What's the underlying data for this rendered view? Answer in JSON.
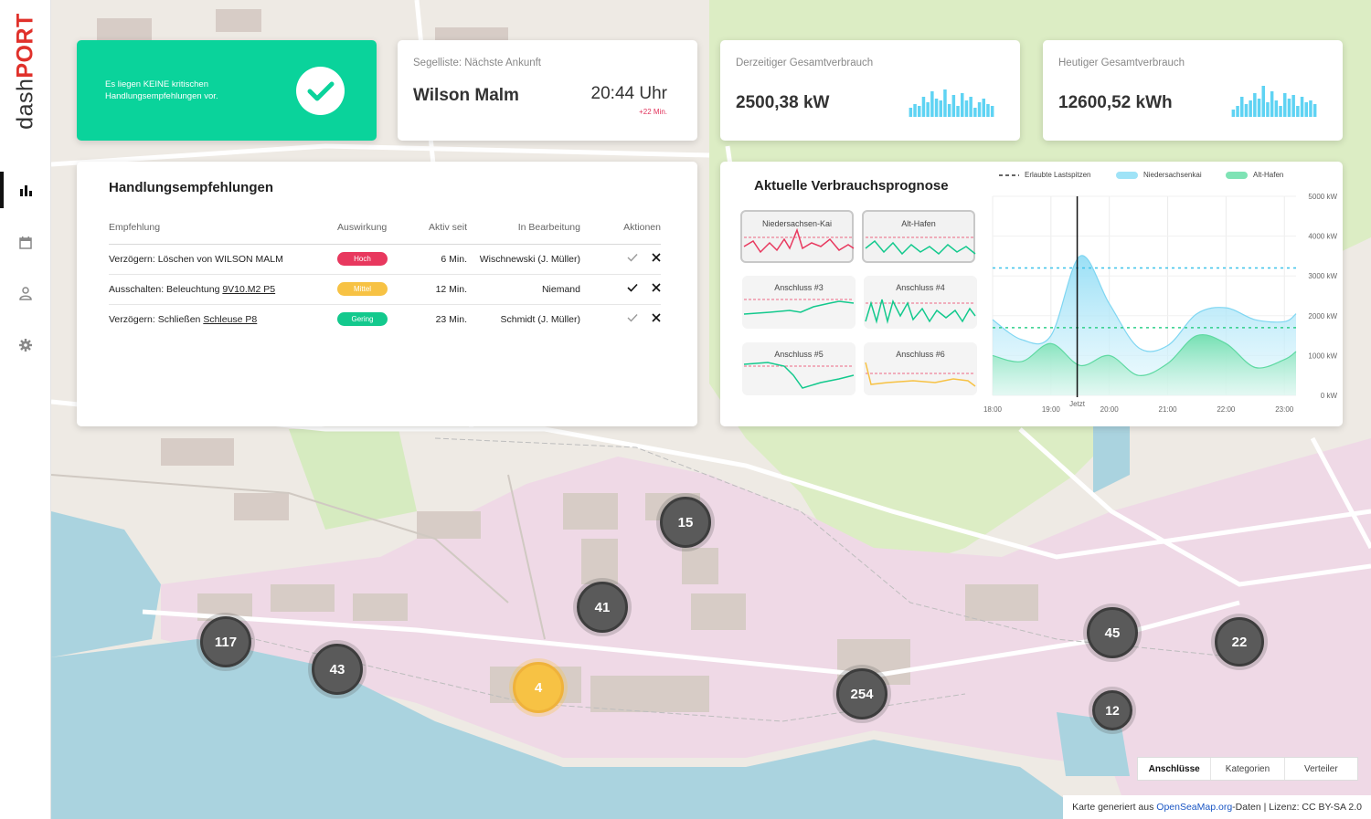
{
  "sidebar": {
    "logo_dash": "dash",
    "logo_port": "PORT",
    "nav": [
      {
        "icon": "bar-chart-icon",
        "active": true
      },
      {
        "icon": "calendar-icon",
        "active": false
      },
      {
        "icon": "user-icon",
        "active": false
      },
      {
        "icon": "gear-icon",
        "active": false
      }
    ]
  },
  "alert": {
    "text": "Es liegen KEINE kritischen Handlungsempfehlungen vor.",
    "icon": "check-icon",
    "color": "#0ad39b"
  },
  "arrival": {
    "label": "Segelliste: Nächste Ankunft",
    "ship": "Wilson Malm",
    "time": "20:44 Uhr",
    "delay": "+22 Min."
  },
  "current_consumption": {
    "label": "Derzeitiger Gesamtverbrauch",
    "value": "2500,38 kW"
  },
  "daily_consumption": {
    "label": "Heutiger Gesamtverbrauch",
    "value": "12600,52 kWh"
  },
  "recommendations": {
    "title": "Handlungsempfehlungen",
    "columns": [
      "Empfehlung",
      "Auswirkung",
      "Aktiv seit",
      "In Bearbeitung",
      "Aktionen"
    ],
    "rows": [
      {
        "prefix": "Verzögern: Löschen von WILSON MALM",
        "link": "",
        "impact": "Hoch",
        "impact_color": "#e8385e",
        "since": "6 Min.",
        "assignee": "Wischnewski (J. Müller)",
        "confirmed": false
      },
      {
        "prefix": "Ausschalten: Beleuchtung ",
        "link": "9V10.M2 P5",
        "impact": "Mittel",
        "impact_color": "#f7c244",
        "since": "12 Min.",
        "assignee": "Niemand",
        "confirmed": true
      },
      {
        "prefix": "Verzögern: Schließen ",
        "link": "Schleuse P8",
        "impact": "Gering",
        "impact_color": "#13c98d",
        "since": "23 Min.",
        "assignee": "Schmidt (J. Müller)",
        "confirmed": false
      }
    ]
  },
  "forecast": {
    "title": "Aktuelle Verbrauchsprognose",
    "sparks": [
      {
        "label": "Niedersachsen-Kai",
        "selected": true,
        "color": "#e8385e"
      },
      {
        "label": "Alt-Hafen",
        "selected": true,
        "color": "#13c98d"
      },
      {
        "label": "Anschluss #3",
        "selected": false,
        "color": "#13c98d"
      },
      {
        "label": "Anschluss #4",
        "selected": false,
        "color": "#13c98d"
      },
      {
        "label": "Anschluss #5",
        "selected": false,
        "color": "#13c98d"
      },
      {
        "label": "Anschluss #6",
        "selected": false,
        "color": "#f7c244"
      }
    ]
  },
  "chart_data": {
    "type": "area",
    "x_ticks": [
      "18:00",
      "19:00",
      "20:00",
      "21:00",
      "22:00",
      "23:00"
    ],
    "y_ticks": [
      "5000 kW",
      "4000 kW",
      "3000 kW",
      "2000 kW",
      "1000 kW",
      "0  kW"
    ],
    "ylim": [
      0,
      5000
    ],
    "now_label": "Jetzt",
    "now_hour": 19.45,
    "legend": [
      "Erlaubte Lastspitzen",
      "Niedersachsenkai",
      "Alt-Hafen"
    ],
    "series": [
      {
        "name": "Niedersachsenkai",
        "color": "#9fe3f7",
        "points": [
          [
            18.0,
            1900
          ],
          [
            18.5,
            1400
          ],
          [
            19.0,
            1500
          ],
          [
            19.5,
            3500
          ],
          [
            20.0,
            2300
          ],
          [
            20.5,
            1200
          ],
          [
            21.0,
            1250
          ],
          [
            21.5,
            2050
          ],
          [
            22.0,
            2200
          ],
          [
            22.5,
            1900
          ],
          [
            23.0,
            1850
          ],
          [
            23.2,
            2050
          ]
        ],
        "limit": 3200
      },
      {
        "name": "Alt-Hafen",
        "color": "#7fe3b5",
        "points": [
          [
            18.0,
            1000
          ],
          [
            18.5,
            850
          ],
          [
            19.0,
            1300
          ],
          [
            19.5,
            750
          ],
          [
            20.0,
            1000
          ],
          [
            20.5,
            500
          ],
          [
            21.0,
            800
          ],
          [
            21.5,
            1500
          ],
          [
            22.0,
            1300
          ],
          [
            22.5,
            700
          ],
          [
            23.0,
            900
          ],
          [
            23.2,
            1100
          ]
        ],
        "limit": 1700
      }
    ]
  },
  "map": {
    "clusters": [
      {
        "label": "15"
      },
      {
        "label": "41"
      },
      {
        "label": "117"
      },
      {
        "label": "43"
      },
      {
        "label": "4"
      },
      {
        "label": "254"
      },
      {
        "label": "45"
      },
      {
        "label": "22"
      },
      {
        "label": "12"
      }
    ],
    "tabs": [
      "Anschlüsse",
      "Kategorien",
      "Verteiler"
    ],
    "attribution_prefix": "Karte generiert aus ",
    "attribution_link": "OpenSeaMap.org",
    "attribution_suffix": "-Daten | Lizenz: CC BY-SA 2.0"
  }
}
